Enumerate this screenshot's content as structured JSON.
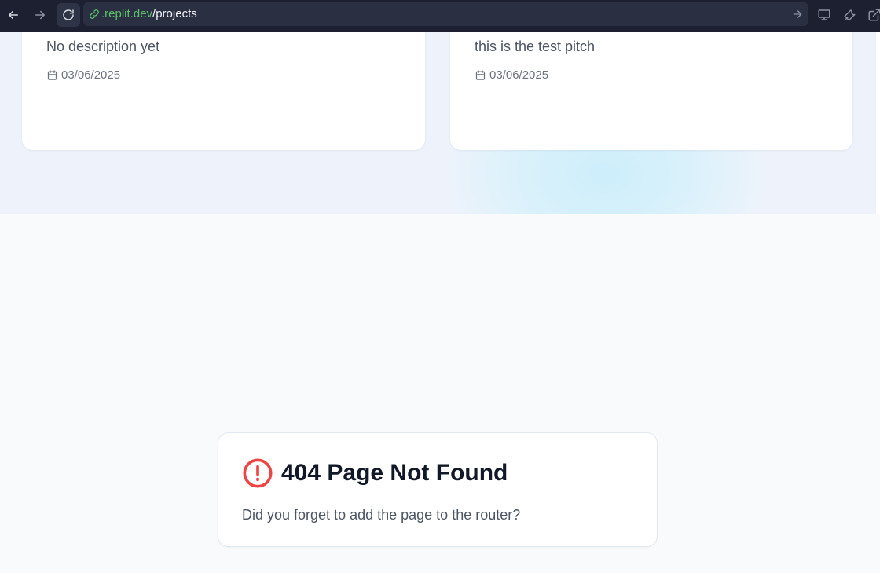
{
  "browser": {
    "url_domain": ".replit.dev",
    "url_path": "/projects"
  },
  "projects": [
    {
      "description": "No description yet",
      "date": "03/06/2025"
    },
    {
      "description": "this is the test pitch",
      "date": "03/06/2025"
    }
  ],
  "not_found": {
    "title": "404 Page Not Found",
    "message": "Did you forget to add the page to the router?"
  },
  "colors": {
    "toolbar": "#1c2030",
    "url_domain": "#5cc26a",
    "error_icon": "#ef4444",
    "page_bg": "#f8fafc"
  },
  "icons": [
    "back-icon",
    "forward-icon",
    "reload-icon",
    "link-icon",
    "go-arrow-icon",
    "monitor-icon",
    "wrench-icon",
    "external-link-icon",
    "calendar-icon",
    "alert-circle-icon"
  ]
}
